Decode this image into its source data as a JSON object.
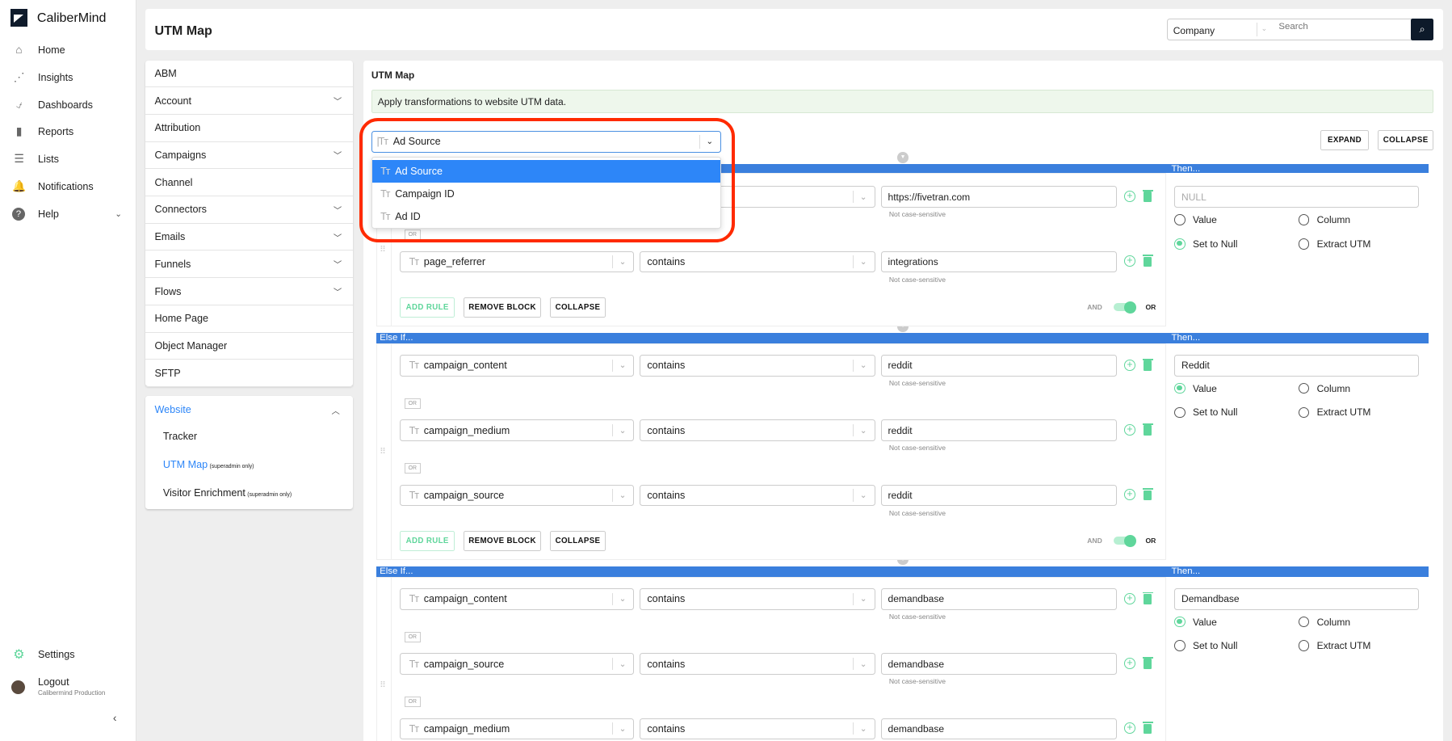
{
  "app": {
    "brand": "CaliberMind"
  },
  "nav": {
    "items": [
      {
        "label": "Home",
        "icon": "home-icon"
      },
      {
        "label": "Insights",
        "icon": "insights-icon"
      },
      {
        "label": "Dashboards",
        "icon": "dashboards-icon"
      },
      {
        "label": "Reports",
        "icon": "bar-chart-icon"
      },
      {
        "label": "Lists",
        "icon": "list-icon"
      },
      {
        "label": "Notifications",
        "icon": "bell-icon"
      },
      {
        "label": "Help",
        "icon": "help-icon"
      }
    ],
    "settings": "Settings",
    "logout": "Logout",
    "org": "Calibermind Production"
  },
  "header": {
    "title": "UTM Map",
    "search_scope": "Company",
    "search_placeholder": "Search"
  },
  "settings_menu": {
    "items": [
      {
        "label": "ABM",
        "expandable": false
      },
      {
        "label": "Account",
        "expandable": true
      },
      {
        "label": "Attribution",
        "expandable": false
      },
      {
        "label": "Campaigns",
        "expandable": true
      },
      {
        "label": "Channel",
        "expandable": false
      },
      {
        "label": "Connectors",
        "expandable": true
      },
      {
        "label": "Emails",
        "expandable": true
      },
      {
        "label": "Funnels",
        "expandable": true
      },
      {
        "label": "Flows",
        "expandable": true
      },
      {
        "label": "Home Page",
        "expandable": false
      },
      {
        "label": "Object Manager",
        "expandable": false
      },
      {
        "label": "SFTP",
        "expandable": false
      }
    ],
    "website": {
      "label": "Website",
      "sub": [
        {
          "label": "Tracker",
          "note": ""
        },
        {
          "label": "UTM Map",
          "note": "(superadmin only)",
          "active": true
        },
        {
          "label": "Visitor Enrichment",
          "note": "(superadmin only)"
        }
      ]
    }
  },
  "main": {
    "title": "UTM Map",
    "info": "Apply transformations to website UTM data.",
    "field_select": {
      "value": "Ad Source",
      "options": [
        "Ad Source",
        "Campaign ID",
        "Ad ID"
      ],
      "highlighted": "Ad Source"
    },
    "expand": "EXPAND",
    "collapse": "COLLAPSE",
    "then_label": "Then...",
    "else_if_label": "Else If...",
    "or_badge": "OR",
    "note": "Not case-sensitive",
    "add_rule": "ADD RULE",
    "remove_block": "REMOVE BLOCK",
    "block_collapse": "COLLAPSE",
    "and_label": "AND",
    "or_label": "OR",
    "radio_labels": [
      "Value",
      "Column",
      "Set to Null",
      "Extract UTM"
    ],
    "null_placeholder": "NULL",
    "blocks": [
      {
        "header": "",
        "rules": [
          {
            "field": "",
            "op": "",
            "value": "https://fivetran.com"
          },
          {
            "field": "page_referrer",
            "op": "contains",
            "value": "integrations"
          }
        ],
        "then_value": "",
        "then_mode": "Set to Null",
        "logic": "OR"
      },
      {
        "header": "Else If...",
        "rules": [
          {
            "field": "campaign_content",
            "op": "contains",
            "value": "reddit"
          },
          {
            "field": "campaign_medium",
            "op": "contains",
            "value": "reddit"
          },
          {
            "field": "campaign_source",
            "op": "contains",
            "value": "reddit"
          }
        ],
        "then_value": "Reddit",
        "then_mode": "Value",
        "logic": "OR"
      },
      {
        "header": "Else If...",
        "rules": [
          {
            "field": "campaign_content",
            "op": "contains",
            "value": "demandbase"
          },
          {
            "field": "campaign_source",
            "op": "contains",
            "value": "demandbase"
          },
          {
            "field": "campaign_medium",
            "op": "contains",
            "value": "demandbase"
          }
        ],
        "then_value": "Demandbase",
        "then_mode": "Value",
        "logic": "OR"
      }
    ]
  },
  "colors": {
    "accent": "#3a7fdd",
    "green": "#5fd69b",
    "highlight": "#ff2a00",
    "selected": "#2d86f8"
  }
}
